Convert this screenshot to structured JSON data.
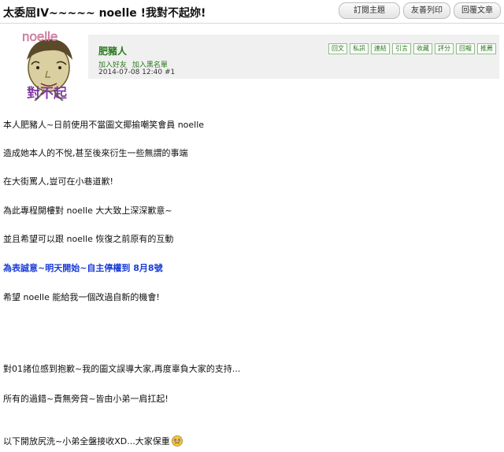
{
  "thread": {
    "title": "太委屈IV~~~~~ noelle !我對不起妳!",
    "buttons": [
      "訂閱主題",
      "友善列印",
      "回覆文章"
    ]
  },
  "post": {
    "avatar_text": {
      "top": "noelle",
      "bottom": "對不起"
    },
    "author": "肥豬人",
    "author_links": [
      "加入好友",
      "加入黑名單"
    ],
    "timestamp": "2014-07-08 12:40",
    "floor": "#1",
    "actions": [
      "回文",
      "私訊",
      "連結",
      "引言",
      "收藏",
      "評分",
      "回報",
      "推薦"
    ],
    "lines": [
      {
        "text": "本人肥豬人~日前使用不當圖文揶揄嘲笑會員 noelle",
        "style": "normal"
      },
      {
        "text": "造成她本人的不悅,甚至後來衍生一些無謂的事端",
        "style": "normal"
      },
      {
        "text": "在大街罵人,豈可在小巷道歉!",
        "style": "normal"
      },
      {
        "text": "為此專程開樓對 noelle 大大致上深深歉意~",
        "style": "normal"
      },
      {
        "text": "並且希望可以跟 noelle 恢復之前原有的互動",
        "style": "normal"
      },
      {
        "text": "為表誠意~明天開始~自主停權到 8月8號",
        "style": "blue"
      },
      {
        "text": "希望 noelle 能給我一個改過自新的機會!",
        "style": "normal"
      },
      {
        "text": "對01諸位感到抱歉~我的圖文誤導大家,再度辜負大家的支持...",
        "style": "normal"
      },
      {
        "text": "所有的過錯~責無旁貸~皆由小弟一肩扛起!",
        "style": "normal"
      },
      {
        "text": "以下開放尻洗~小弟全盤接收XD...大家保重",
        "style": "normal"
      }
    ]
  }
}
